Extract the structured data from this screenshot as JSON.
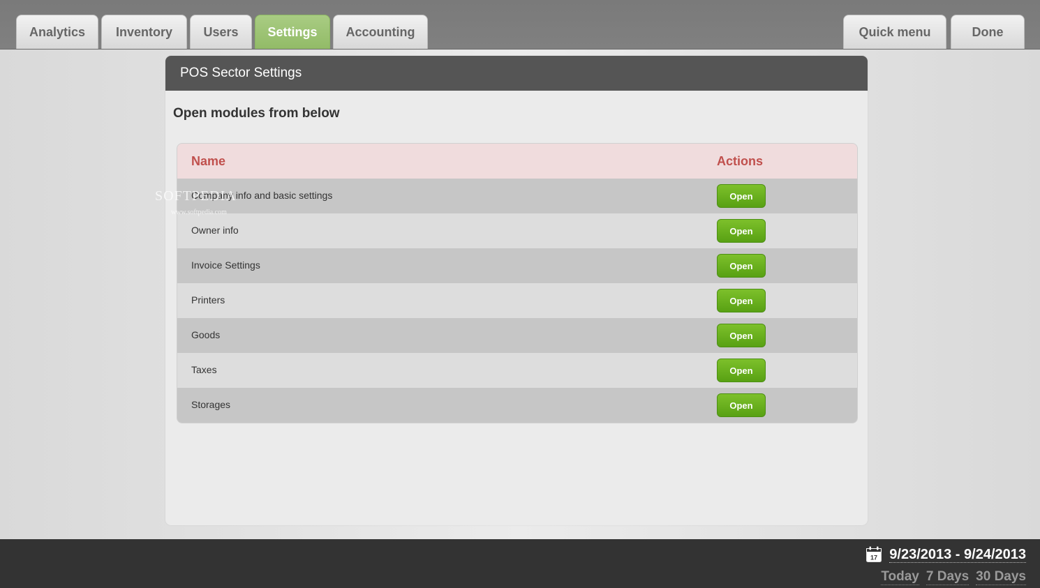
{
  "tabs": [
    {
      "label": "Analytics"
    },
    {
      "label": "Inventory"
    },
    {
      "label": "Users"
    },
    {
      "label": "Settings"
    },
    {
      "label": "Accounting"
    }
  ],
  "active_tab": "Settings",
  "right_buttons": {
    "quick_menu": "Quick menu",
    "done": "Done"
  },
  "panel": {
    "title": "POS Sector Settings",
    "subtitle": "Open modules from below"
  },
  "table": {
    "headers": {
      "name": "Name",
      "actions": "Actions"
    },
    "rows": [
      {
        "name": "Company info and basic settings",
        "action": "Open"
      },
      {
        "name": "Owner info",
        "action": "Open"
      },
      {
        "name": "Invoice Settings",
        "action": "Open"
      },
      {
        "name": "Printers",
        "action": "Open"
      },
      {
        "name": "Goods",
        "action": "Open"
      },
      {
        "name": "Taxes",
        "action": "Open"
      },
      {
        "name": "Storages",
        "action": "Open"
      }
    ]
  },
  "watermark": {
    "text": "SOFTPEDIA",
    "url": "www.softpedia.com"
  },
  "footer": {
    "calendar_icon": "calendar-icon",
    "calendar_day": "17",
    "date_range": "9/23/2013 - 9/24/2013",
    "presets": [
      "Today",
      "7 Days",
      "30 Days"
    ]
  },
  "colors": {
    "accent_green": "#6ab01f",
    "header_dark": "#555555",
    "table_header_bg": "#f0dcdd",
    "table_header_text": "#c0504d"
  }
}
